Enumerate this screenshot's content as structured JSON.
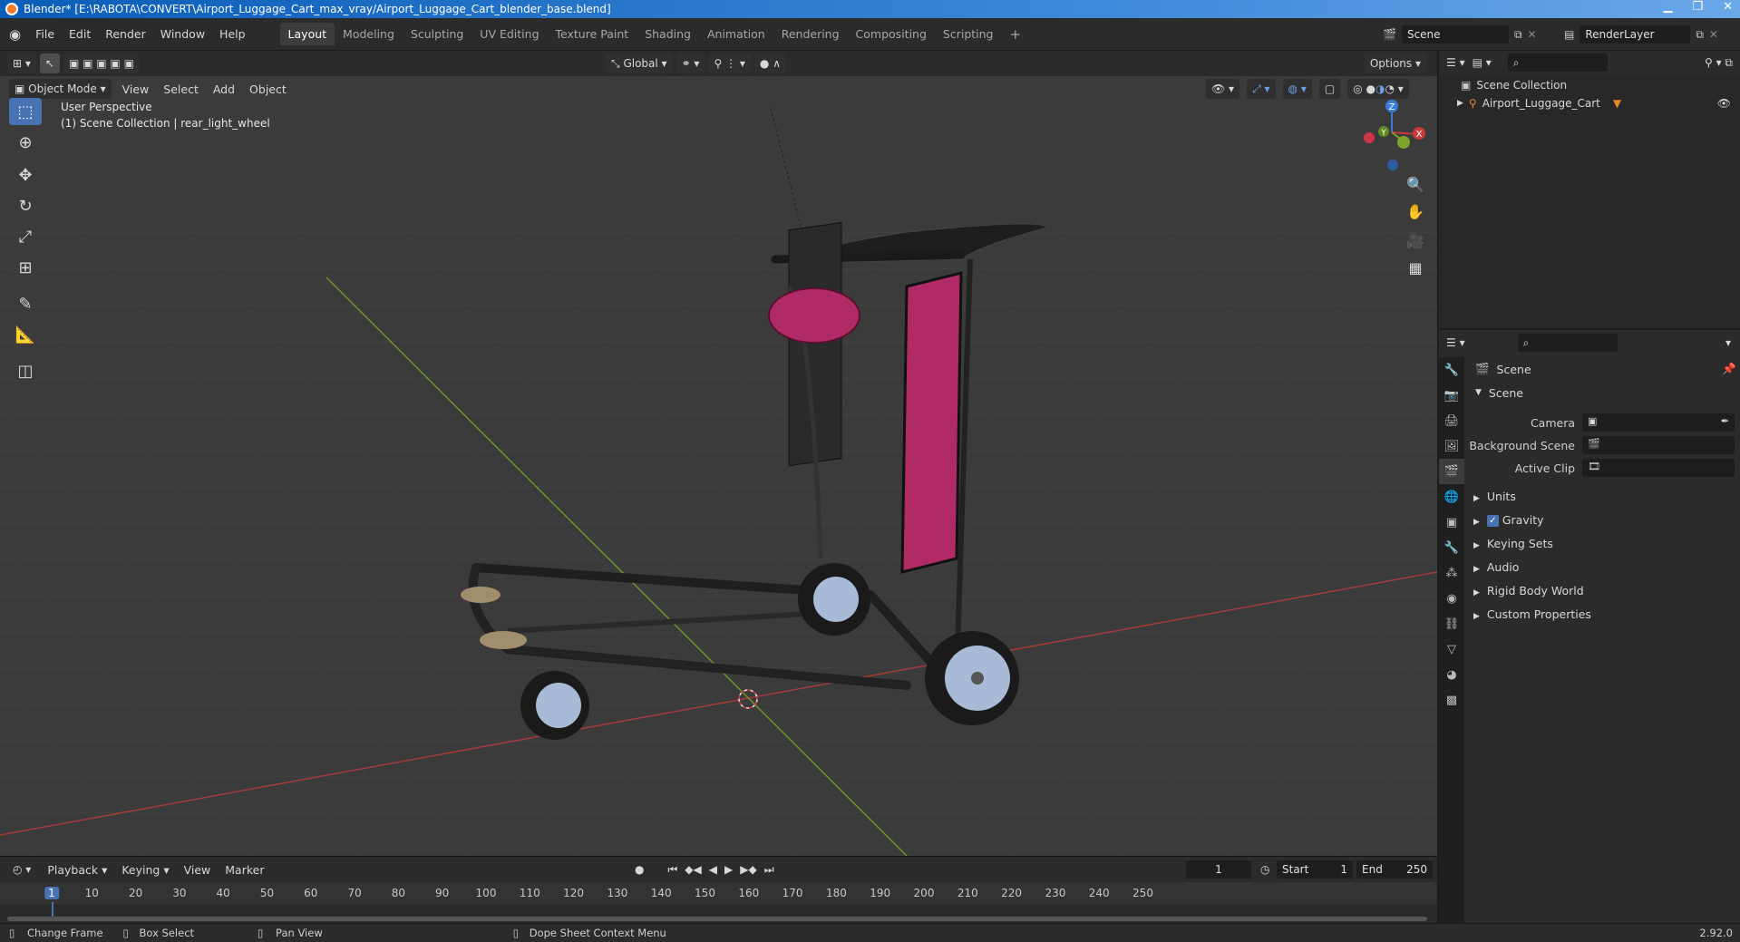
{
  "window": {
    "title": "Blender* [E:\\RABOTA\\CONVERT\\Airport_Luggage_Cart_max_vray/Airport_Luggage_Cart_blender_base.blend]"
  },
  "menubar": {
    "menus": [
      "File",
      "Edit",
      "Render",
      "Window",
      "Help"
    ],
    "workspace_tabs": [
      "Layout",
      "Modeling",
      "Sculpting",
      "UV Editing",
      "Texture Paint",
      "Shading",
      "Animation",
      "Rendering",
      "Compositing",
      "Scripting"
    ],
    "active_tab": "Layout",
    "scene_name": "Scene",
    "view_layer": "RenderLayer"
  },
  "viewport": {
    "transform_orientation": "Global",
    "options_label": "Options",
    "mode": "Object Mode",
    "menus": [
      "View",
      "Select",
      "Add",
      "Object"
    ],
    "info_line1": "User Perspective",
    "info_line2": "(1) Scene Collection | rear_light_wheel",
    "gizmo_z": "Z",
    "gizmo_y": "Y",
    "gizmo_x": "X"
  },
  "outliner": {
    "root": "Scene Collection",
    "items": [
      {
        "name": "Airport_Luggage_Cart"
      }
    ]
  },
  "properties": {
    "header": "Scene",
    "section": "Scene",
    "fields": [
      {
        "label": "Camera",
        "value": ""
      },
      {
        "label": "Background Scene",
        "value": ""
      },
      {
        "label": "Active Clip",
        "value": ""
      }
    ],
    "panels": [
      {
        "label": "Units",
        "checkbox": false
      },
      {
        "label": "Gravity",
        "checkbox": true
      },
      {
        "label": "Keying Sets",
        "checkbox": false
      },
      {
        "label": "Audio",
        "checkbox": false
      },
      {
        "label": "Rigid Body World",
        "checkbox": false
      },
      {
        "label": "Custom Properties",
        "checkbox": false
      }
    ]
  },
  "timeline": {
    "menus": [
      "Playback",
      "Keying",
      "View",
      "Marker"
    ],
    "current_frame": "1",
    "start_label": "Start",
    "start": "1",
    "end_label": "End",
    "end": "250",
    "ticks": [
      "1",
      "10",
      "20",
      "30",
      "40",
      "50",
      "60",
      "70",
      "80",
      "90",
      "100",
      "110",
      "120",
      "130",
      "140",
      "150",
      "160",
      "170",
      "180",
      "190",
      "200",
      "210",
      "220",
      "230",
      "240",
      "250"
    ]
  },
  "statusbar": {
    "items": [
      "Change Frame",
      "Box Select",
      "Pan View",
      "Dope Sheet Context Menu"
    ],
    "version": "2.92.0"
  },
  "colors": {
    "accent": "#4772b3",
    "x_axis": "#c83a3a",
    "y_axis": "#7da32b",
    "z_axis": "#3a7ad8",
    "cart_panel": "#b02a66"
  }
}
